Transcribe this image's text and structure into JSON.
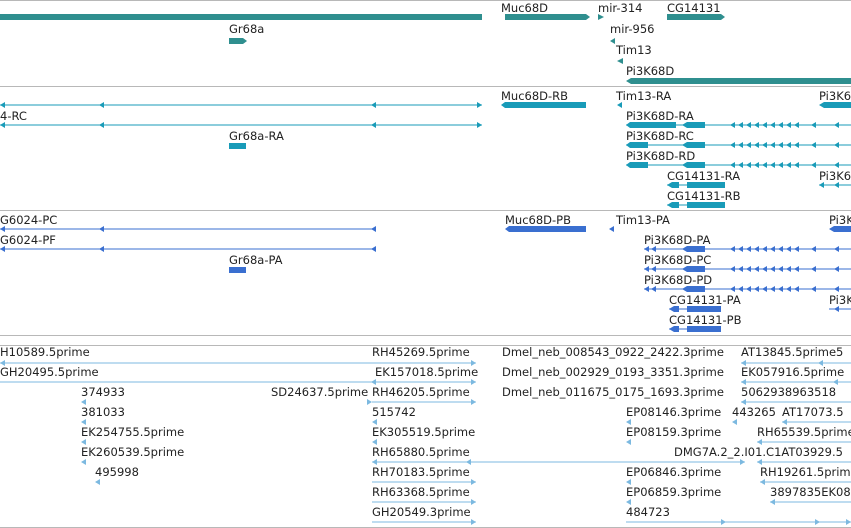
{
  "colors": {
    "gene": "#2f8f8f",
    "mrna": "#199bb8",
    "protein": "#3a6fd0",
    "est": "#7cb9e0",
    "separator": "#b8b8b8",
    "text": "#222222"
  },
  "tracks": [
    {
      "id": "genes",
      "color": "gene",
      "features": [
        {
          "label": "Muc68D"
        },
        {
          "label": "mir-314"
        },
        {
          "label": "CG14131"
        },
        {
          "label": "Gr68a"
        },
        {
          "label": "mir-956"
        },
        {
          "label": "Tim13"
        },
        {
          "label": "Pi3K68D"
        }
      ]
    },
    {
      "id": "transcripts",
      "color": "mrna",
      "features": [
        {
          "label": "Muc68D-RB"
        },
        {
          "label": "Tim13-RA"
        },
        {
          "label": "Pi3K6"
        },
        {
          "label": "4-RC"
        },
        {
          "label": "Pi3K68D-RA"
        },
        {
          "label": "Gr68a-RA"
        },
        {
          "label": "Pi3K68D-RC"
        },
        {
          "label": "Pi3K68D-RD"
        },
        {
          "label": "CG14131-RA"
        },
        {
          "label": "Pi3K6"
        },
        {
          "label": "CG14131-RB"
        }
      ]
    },
    {
      "id": "proteins",
      "color": "protein",
      "features": [
        {
          "label": "G6024-PC"
        },
        {
          "label": "Muc68D-PB"
        },
        {
          "label": "Tim13-PA"
        },
        {
          "label": "Pi3K"
        },
        {
          "label": "G6024-PF"
        },
        {
          "label": "Pi3K68D-PA"
        },
        {
          "label": "Gr68a-PA"
        },
        {
          "label": "Pi3K68D-PC"
        },
        {
          "label": "Pi3K68D-PD"
        },
        {
          "label": "CG14131-PA"
        },
        {
          "label": "Pi3K"
        },
        {
          "label": "CG14131-PB"
        }
      ]
    },
    {
      "id": "ests",
      "color": "est",
      "features": [
        {
          "label": "H10589.5prime"
        },
        {
          "label": "RH45269.5prime"
        },
        {
          "label": "Dmel_neb_008543_0922_2422.3prime"
        },
        {
          "label": "AT13845.5prime5"
        },
        {
          "label": "GH20495.5prime"
        },
        {
          "label": "EK157018.5prime"
        },
        {
          "label": "Dmel_neb_002929_0193_3351.3prime"
        },
        {
          "label": "EK057916.5prime"
        },
        {
          "label": "374933"
        },
        {
          "label": "SD24637.5prime"
        },
        {
          "label": "RH46205.5prime"
        },
        {
          "label": "Dmel_neb_011675_0175_1693.3prime"
        },
        {
          "label": "5062938963518"
        },
        {
          "label": "381033"
        },
        {
          "label": "515742"
        },
        {
          "label": "EP08146.3prime"
        },
        {
          "label": "443265"
        },
        {
          "label": "AT17073.5"
        },
        {
          "label": "EK254755.5prime"
        },
        {
          "label": "EK305519.5prime"
        },
        {
          "label": "EP08159.3prime"
        },
        {
          "label": "RH65539.5prime"
        },
        {
          "label": "EK260539.5prime"
        },
        {
          "label": "RH65880.5prime"
        },
        {
          "label": "DMG7A.2_2.I01.C1AT03929.5"
        },
        {
          "label": "495998"
        },
        {
          "label": "RH70183.5prime"
        },
        {
          "label": "EP06846.3prime"
        },
        {
          "label": "RH19261.5prim"
        },
        {
          "label": "RH63368.5prime"
        },
        {
          "label": "EP06859.3prime"
        },
        {
          "label": "3897835EK08"
        },
        {
          "label": "GH20549.3prime"
        },
        {
          "label": "484723"
        }
      ]
    }
  ]
}
